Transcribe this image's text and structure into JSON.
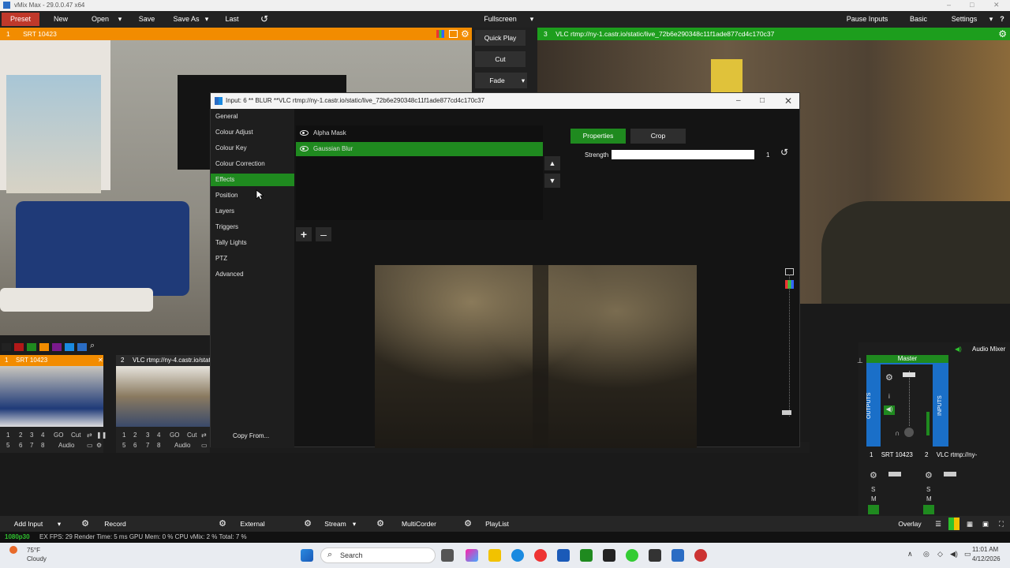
{
  "window": {
    "title": "vMix Max - 29.0.0.47 x64",
    "controls": [
      "–",
      "□",
      "✕"
    ]
  },
  "menubar": {
    "preset": "Preset",
    "new": "New",
    "open": "Open",
    "save": "Save",
    "save_as": "Save As",
    "last": "Last",
    "fullscreen": "Fullscreen",
    "pause_inputs": "Pause Inputs",
    "basic": "Basic",
    "settings": "Settings"
  },
  "preview": {
    "number": "1",
    "name": "SRT  10423"
  },
  "output": {
    "number": "3",
    "name": "VLC rtmp://ny-1.castr.io/static/live_72b6e290348c11f1ade877cd4c170c37"
  },
  "transitions": {
    "quick_play": "Quick Play",
    "cut": "Cut",
    "fade": "Fade"
  },
  "dialog": {
    "title": "Input: 6 ** BLUR **VLC rtmp://ny-1.castr.io/static/live_72b6e290348c11f1ade877cd4c170c37",
    "nav": [
      "General",
      "Colour Adjust",
      "Colour Key",
      "Colour Correction",
      "Effects",
      "Position",
      "Layers",
      "Triggers",
      "Tally Lights",
      "PTZ",
      "Advanced"
    ],
    "nav_selected": "Effects",
    "effects": [
      "Alpha Mask",
      "Gaussian Blur"
    ],
    "effect_selected": "Gaussian Blur",
    "add_label": "+",
    "remove_label": "–",
    "tab_properties": "Properties",
    "tab_crop": "Crop",
    "strength_label": "Strength",
    "strength_value": "1",
    "copy_from": "Copy From..."
  },
  "inputs": [
    {
      "number": "1",
      "name": "SRT  10423",
      "row1": [
        "1",
        "2",
        "3",
        "4",
        "GO",
        "Cut"
      ],
      "row2": [
        "5",
        "6",
        "7",
        "8",
        "Audio"
      ]
    },
    {
      "number": "2",
      "name": "VLC rtmp://ny-4.castr.io/static/",
      "row1": [
        "1",
        "2",
        "3",
        "4",
        "GO",
        "Cut"
      ],
      "row2": [
        "5",
        "6",
        "7",
        "8",
        "Audio"
      ]
    }
  ],
  "audio_mixer": {
    "label": "Audio Mixer",
    "master": "Master",
    "outputs": "OUTPUTS",
    "inputs": "INPUTS",
    "channels": [
      {
        "number": "1",
        "name": "SRT  10423"
      },
      {
        "number": "2",
        "name": "VLC rtmp://ny-"
      }
    ],
    "s_label": "S",
    "m_label": "M",
    "i_label": "i"
  },
  "bottombar": {
    "add_input": "Add Input",
    "record": "Record",
    "external": "External",
    "stream": "Stream",
    "multicorder": "MultiCorder",
    "playlist": "PlayList",
    "overlay": "Overlay"
  },
  "status": {
    "resolution": "1080p30",
    "text": "EX  FPS: 29  Render Time: 5 ms  GPU Mem: 0 %  CPU vMix: 2 %  Total: 7 %"
  },
  "taskbar": {
    "weather_temp": "75°F",
    "weather_desc": "Cloudy",
    "search": "Search",
    "time": "11:01 AM",
    "date": "4/12/2026"
  },
  "colors": {
    "accent_green": "#1f8a1f",
    "preview_orange": "#f28c00",
    "output_green": "#1d9e1d",
    "blue": "#1a6fc8"
  }
}
